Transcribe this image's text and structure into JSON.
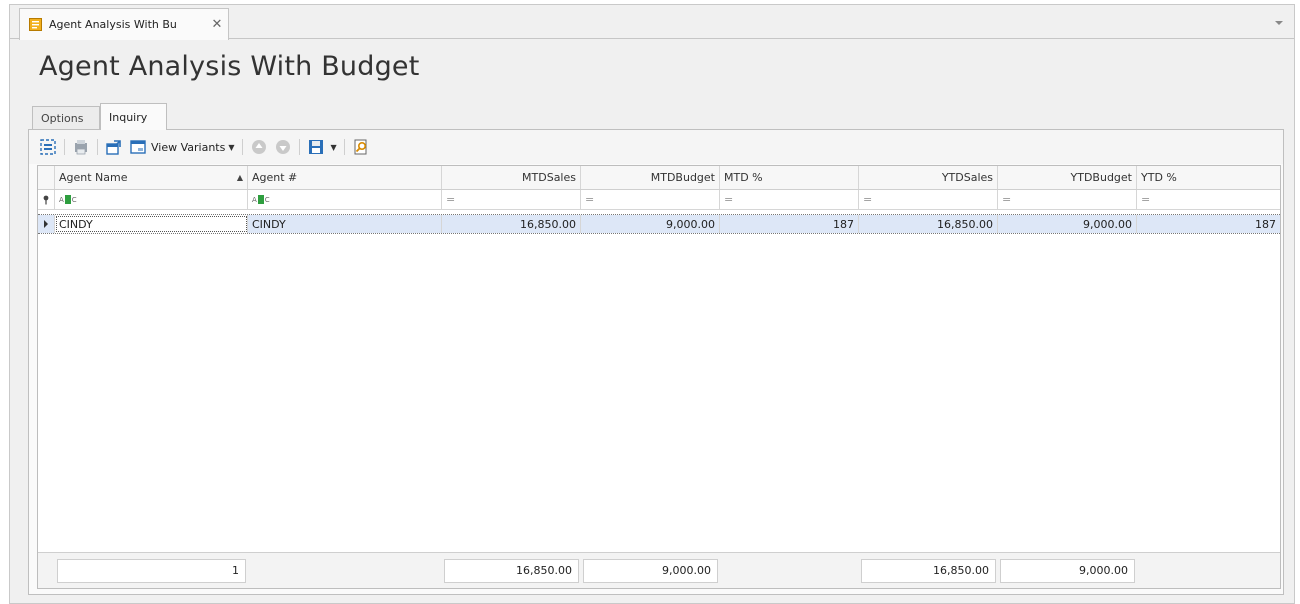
{
  "window": {
    "doc_tab_title": "Agent Analysis With Bu",
    "page_title": "Agent Analysis With Budget"
  },
  "sub_tabs": {
    "options": "Options",
    "inquiry": "Inquiry"
  },
  "toolbar": {
    "view_variants_label": "View Variants",
    "icons": [
      "group-panel-icon",
      "print-preview-icon",
      "export-window-icon",
      "view-variants-icon",
      "up-icon",
      "down-icon",
      "save-layout-icon",
      "dropdown-icon",
      "search-report-icon"
    ]
  },
  "grid": {
    "columns": [
      {
        "label": "Agent Name"
      },
      {
        "label": "Agent #"
      },
      {
        "label": "MTDSales"
      },
      {
        "label": "MTDBudget"
      },
      {
        "label": "MTD %"
      },
      {
        "label": "YTDSales"
      },
      {
        "label": "YTDBudget"
      },
      {
        "label": "YTD %"
      }
    ],
    "filter_symbol": "=",
    "rows": [
      {
        "agent_name": "CINDY",
        "agent_no": "CINDY",
        "mtd_sales": "16,850.00",
        "mtd_budget": "9,000.00",
        "mtd_pct": "187",
        "ytd_sales": "16,850.00",
        "ytd_budget": "9,000.00",
        "ytd_pct": "187"
      }
    ],
    "footer": {
      "count": "1",
      "mtd_sales": "16,850.00",
      "mtd_budget": "9,000.00",
      "ytd_sales": "16,850.00",
      "ytd_budget": "9,000.00"
    }
  },
  "colors": {
    "selected_row": "#dde7f7",
    "abc_filter_green": "#2e9e3f"
  }
}
